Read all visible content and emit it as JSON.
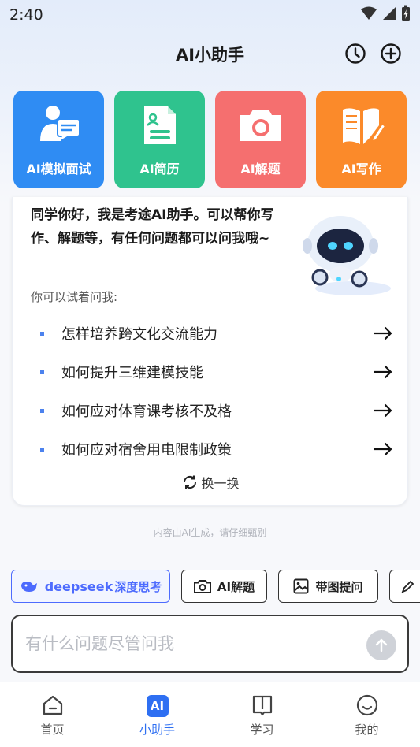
{
  "status": {
    "time": "2:40"
  },
  "header": {
    "title": "AI小助手"
  },
  "tiles": [
    {
      "label": "AI模拟面试",
      "color": "#2f8cf3"
    },
    {
      "label": "AI简历",
      "color": "#2fc38e"
    },
    {
      "label": "AI解题",
      "color": "#f56f6f"
    },
    {
      "label": "AI写作",
      "color": "#fb8a2a"
    }
  ],
  "card": {
    "greeting": "同学你好，我是考途AI助手。可以帮你写作、解题等，有任何问题都可以问我哦~",
    "hint": "你可以试着问我:",
    "suggestions": [
      "怎样培养跨文化交流能力",
      "如何提升三维建模技能",
      "如何应对体育课考核不及格",
      "如何应对宿舍用电限制政策"
    ],
    "refresh_label": "换一换"
  },
  "disclaimer": "内容由AI生成，请仔细甄别",
  "chips": {
    "deepseek_brand": "deepseek",
    "deepseek_label": "深度思考",
    "solve": "AI解题",
    "image_ask": "带图提问"
  },
  "input": {
    "placeholder": "有什么问题尽管问我"
  },
  "tabs": [
    {
      "label": "首页"
    },
    {
      "label": "小助手",
      "icon_text": "AI"
    },
    {
      "label": "学习"
    },
    {
      "label": "我的"
    }
  ],
  "colors": {
    "accent": "#2e6ff2",
    "deepseek": "#4d6bfe"
  }
}
